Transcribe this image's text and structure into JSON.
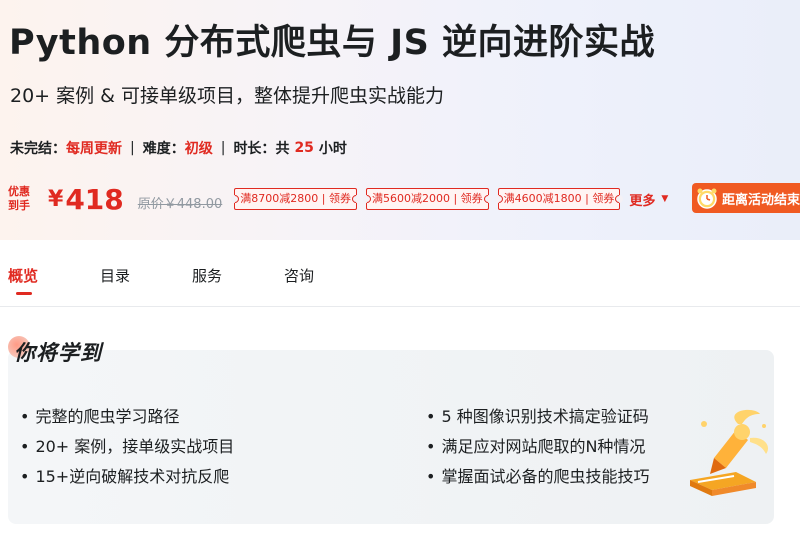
{
  "course": {
    "title": "Python 分布式爬虫与 JS 逆向进阶实战",
    "subtitle": "20+ 案例 & 可接单级项目，整体提升爬虫实战能力"
  },
  "meta": {
    "status_label": "未完结：",
    "status_value": "每周更新",
    "difficulty_label": "难度：",
    "difficulty_value": "初级",
    "duration_label": "时长：",
    "duration_prefix": "共",
    "duration_value": "25",
    "duration_unit": "小时",
    "separator": "|"
  },
  "pricing": {
    "promo_tag_line1": "优惠",
    "promo_tag_line2": "到手",
    "currency": "¥",
    "price": "418",
    "original_price": "原价￥448.00",
    "coupons": [
      "满8700减2800 | 领券",
      "满5600减2000 | 领券",
      "满4600减1800 | 领券"
    ],
    "more_label": "更多",
    "countdown_label": "距离活动结束"
  },
  "tabs": [
    "概览",
    "目录",
    "服务",
    "咨询"
  ],
  "learn": {
    "heading": "你将学到",
    "left_items": [
      "完整的爬虫学习路径",
      "20+ 案例，接单级实战项目",
      "15+逆向破解技术对抗反爬"
    ],
    "right_items": [
      "5 种图像识别技术搞定验证码",
      "满足应对网站爬取的N种情况",
      "掌握面试必备的爬虫技能技巧"
    ]
  },
  "colors": {
    "accent": "#e02a21",
    "countdown_bg": "#f05a22",
    "text": "#1c1f21"
  }
}
